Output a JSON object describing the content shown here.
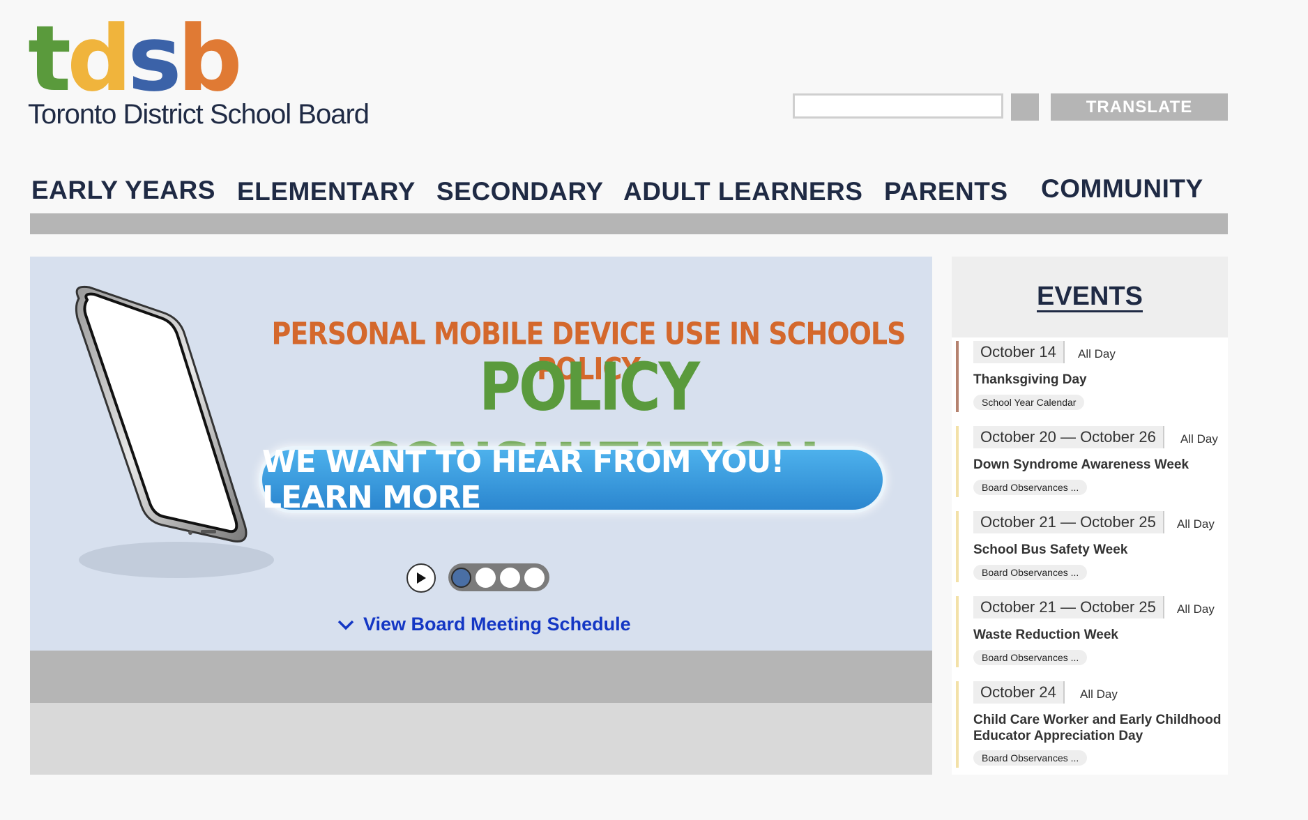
{
  "logo": {
    "letters": [
      {
        "ch": "t",
        "color": "#5a9a3c"
      },
      {
        "ch": "d",
        "color": "#f0b43c"
      },
      {
        "ch": "s",
        "color": "#3b62a8"
      },
      {
        "ch": "b",
        "color": "#e07a34"
      }
    ],
    "name": "Toronto District School Board"
  },
  "header": {
    "search_placeholder": "",
    "translate_label": "TRANSLATE"
  },
  "nav": {
    "items": [
      "EARLY YEARS",
      "ELEMENTARY",
      "SECONDARY",
      "ADULT LEARNERS",
      "PARENTS",
      "COMMUNITY"
    ]
  },
  "hero": {
    "title_line1": "PERSONAL MOBILE DEVICE USE IN SCHOOLS POLICY",
    "title_line2": "POLICY CONSULTATION",
    "cta": "WE WANT TO HEAR FROM YOU! LEARN MORE",
    "slides_total": 4,
    "slide_active": 1,
    "view_link": "View Board Meeting Schedule"
  },
  "events": {
    "title": "EVENTS",
    "items": [
      {
        "date": "October 14",
        "time": "All Day",
        "name": "Thanksgiving Day",
        "category": "School Year Calendar",
        "accent": "#b5826f"
      },
      {
        "date": "October 20 — October 26",
        "time": "All Day",
        "name": "Down Syndrome Awareness Week",
        "category": "Board Observances ...",
        "accent": "#f3e1a8"
      },
      {
        "date": "October 21 — October 25",
        "time": "All Day",
        "name": "School Bus Safety Week",
        "category": "Board Observances ...",
        "accent": "#f3e1a8"
      },
      {
        "date": "October 21 — October 25",
        "time": "All Day",
        "name": "Waste Reduction Week",
        "category": "Board Observances ...",
        "accent": "#f3e1a8"
      },
      {
        "date": "October 24",
        "time": "All Day",
        "name": "Child Care Worker and Early Childhood Educator Appreciation Day",
        "category": "Board Observances ...",
        "accent": "#f3e1a8"
      }
    ]
  }
}
